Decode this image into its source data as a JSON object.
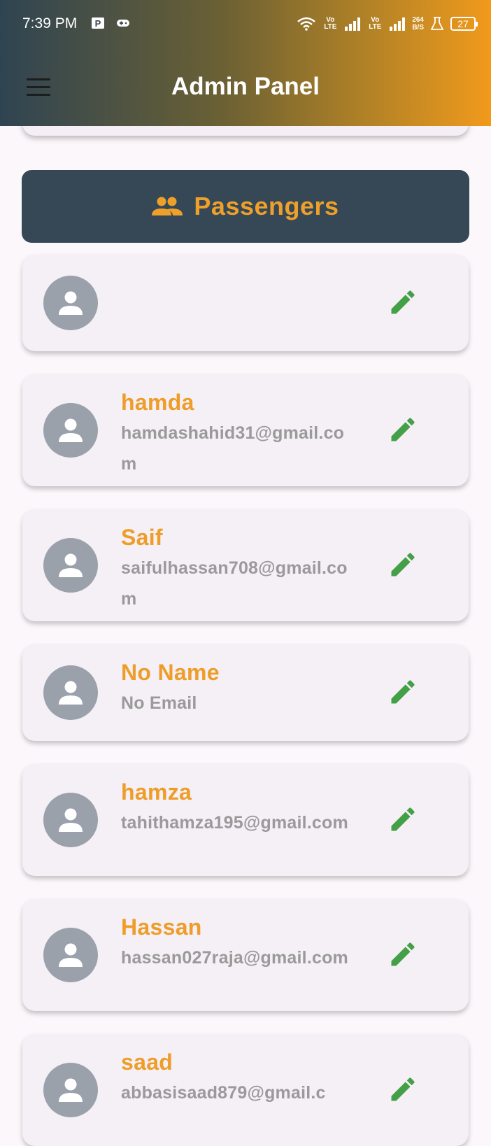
{
  "status_bar": {
    "time": "7:39 PM",
    "volte1": "Vo LTE",
    "volte2": "Vo LTE",
    "speed_value": "264",
    "speed_unit": "B/S",
    "battery": "27",
    "icons": [
      "parking-notification-icon",
      "gamepad-icon",
      "wifi-icon",
      "signal-icon",
      "flask-icon",
      "battery-icon"
    ]
  },
  "app_bar": {
    "title": "Admin Panel",
    "menu_icon": "menu-icon",
    "gradient_colors": [
      "#2f4452",
      "#f19a1c"
    ]
  },
  "section": {
    "title": "Passengers",
    "icon": "people-icon",
    "accent": "#eda02a",
    "background": "#364756"
  },
  "passengers": [
    {
      "name": "",
      "email": ""
    },
    {
      "name": "hamda",
      "email": "hamdashahid31@gmail.com"
    },
    {
      "name": "Saif",
      "email": "saifulhassan708@gmail.com"
    },
    {
      "name": "No Name",
      "email": "No Email"
    },
    {
      "name": "hamza",
      "email": "tahithamza195@gmail.com"
    },
    {
      "name": "Hassan",
      "email": "hassan027raja@gmail.com"
    },
    {
      "name": "saad",
      "email": "abbasisaad879@gmail.c"
    }
  ],
  "colors": {
    "name": "#ee9d28",
    "email": "#9a9a9a",
    "edit": "#43a047",
    "avatar": "#9aa1ab"
  }
}
